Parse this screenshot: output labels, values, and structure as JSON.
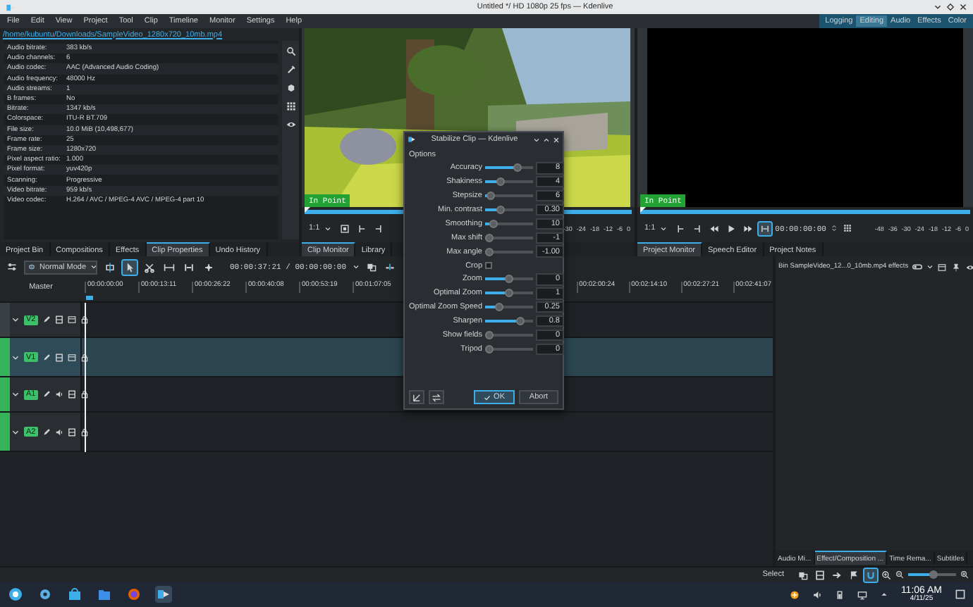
{
  "window": {
    "title": "Untitled */ HD 1080p 25 fps — Kdenlive"
  },
  "menu": [
    "File",
    "Edit",
    "View",
    "Project",
    "Tool",
    "Clip",
    "Timeline",
    "Monitor",
    "Settings",
    "Help"
  ],
  "layouts": [
    {
      "label": "Logging",
      "selected": false
    },
    {
      "label": "Editing",
      "selected": true
    },
    {
      "label": "Audio",
      "selected": false
    },
    {
      "label": "Effects",
      "selected": false
    },
    {
      "label": "Color",
      "selected": false
    }
  ],
  "clip_properties": {
    "path": "/home/kubuntu/Downloads/SampleVideo_1280x720_10mb.mp4",
    "rows": [
      {
        "name": "Audio bitrate:",
        "value": "383 kb/s"
      },
      {
        "name": "Audio channels:",
        "value": "6"
      },
      {
        "name": "Audio codec:",
        "value": "AAC (Advanced Audio Coding)"
      },
      {
        "name": "Audio frequency:",
        "value": "48000 Hz"
      },
      {
        "name": "Audio streams:",
        "value": "1"
      },
      {
        "name": "B frames:",
        "value": "No"
      },
      {
        "name": "Bitrate:",
        "value": "1347 kb/s"
      },
      {
        "name": "Colorspace:",
        "value": "ITU-R BT.709"
      },
      {
        "name": "File size:",
        "value": "10.0 MiB (10,498,677)"
      },
      {
        "name": "Frame rate:",
        "value": "25"
      },
      {
        "name": "Frame size:",
        "value": "1280x720"
      },
      {
        "name": "Pixel aspect ratio:",
        "value": "1.000"
      },
      {
        "name": "Pixel format:",
        "value": "yuv420p"
      },
      {
        "name": "Scanning:",
        "value": "Progressive"
      },
      {
        "name": "Video bitrate:",
        "value": "959 kb/s"
      },
      {
        "name": "Video codec:",
        "value": "H.264 / AVC / MPEG-4 AVC / MPEG-4 part 10"
      }
    ]
  },
  "left_tabs": [
    {
      "label": "Project Bin",
      "selected": false
    },
    {
      "label": "Compositions",
      "selected": false
    },
    {
      "label": "Effects",
      "selected": false
    },
    {
      "label": "Clip Properties",
      "selected": true
    },
    {
      "label": "Undo History",
      "selected": false
    }
  ],
  "clip_monitor": {
    "in_point": "In Point",
    "zoom": "1:1",
    "meter_scale": [
      "-30",
      "-24",
      "-18",
      "-12",
      "-6",
      "0"
    ],
    "tabs": [
      {
        "label": "Clip Monitor",
        "selected": true
      },
      {
        "label": "Library",
        "selected": false
      }
    ]
  },
  "project_monitor": {
    "in_point": "In Point",
    "zoom": "1:1",
    "timecode": "00:00:00:00",
    "meter_scale": [
      "-48",
      "-36",
      "-30",
      "-24",
      "-18",
      "-12",
      "-6",
      "0"
    ],
    "tabs": [
      {
        "label": "Project Monitor",
        "selected": true
      },
      {
        "label": "Speech Editor",
        "selected": false
      },
      {
        "label": "Project Notes",
        "selected": false
      }
    ]
  },
  "timeline": {
    "mode": "Normal Mode",
    "timecode": "00:00:37:21 / 00:00:00:00",
    "tools": [
      {
        "selected": false
      },
      {
        "selected": true
      },
      {
        "selected": false
      },
      {
        "selected": false
      },
      {
        "selected": false
      },
      {
        "selected": false
      }
    ],
    "master": "Master",
    "ruler_left": [
      "00:00:00:00",
      "00:00:13:11",
      "00:00:26:22",
      "00:00:40:08",
      "00:00:53:19",
      "00:01:07:05"
    ],
    "ruler_right": [
      "00:02:00:24",
      "00:02:14:10",
      "00:02:27:21",
      "00:02:41:07"
    ],
    "tracks": [
      {
        "name": "V2",
        "kind": "video",
        "selected": false,
        "target": false
      },
      {
        "name": "V1",
        "kind": "video",
        "selected": true,
        "target": true
      },
      {
        "name": "A1",
        "kind": "audio",
        "selected": false,
        "target": true
      },
      {
        "name": "A2",
        "kind": "audio",
        "selected": false,
        "target": true
      }
    ]
  },
  "effects_panel": {
    "title": "Bin SampleVideo_12...0_10mb.mp4 effects",
    "tabs": [
      {
        "label": "Audio Mi...",
        "selected": false
      },
      {
        "label": "Effect/Composition ...",
        "selected": true
      },
      {
        "label": "Time Rema...",
        "selected": false
      },
      {
        "label": "Subtitles",
        "selected": false
      }
    ]
  },
  "status_bar": {
    "mode": "Select",
    "zoom": {
      "level": 0.55
    }
  },
  "taskbar": {
    "time": "11:06 AM",
    "date": "4/11/25"
  },
  "dialog": {
    "title": "Stabilize Clip — Kdenlive",
    "section": "Options",
    "params": [
      {
        "kind": "slider",
        "label": "Accuracy",
        "value": "8",
        "level": 0.72
      },
      {
        "kind": "slider",
        "label": "Shakiness",
        "value": "4",
        "level": 0.3
      },
      {
        "kind": "slider",
        "label": "Stepsize",
        "value": "6",
        "level": 0.05
      },
      {
        "kind": "slider",
        "label": "Min. contrast",
        "value": "0.30",
        "level": 0.3
      },
      {
        "kind": "slider",
        "label": "Smoothing",
        "value": "10",
        "level": 0.1
      },
      {
        "kind": "slider",
        "label": "Max shift",
        "value": "-1",
        "level": 0
      },
      {
        "kind": "slider",
        "label": "Max angle",
        "value": "-1.00",
        "level": 0
      },
      {
        "kind": "checkbox",
        "label": "Crop",
        "checked": false
      },
      {
        "kind": "slider",
        "label": "Zoom",
        "value": "0",
        "level": 0.5
      },
      {
        "kind": "slider",
        "label": "Optimal Zoom",
        "value": "1",
        "level": 0.5
      },
      {
        "kind": "slider",
        "label": "Optimal Zoom Speed",
        "value": "0.25",
        "level": 0.25
      },
      {
        "kind": "slider",
        "label": "Sharpen",
        "value": "0.8",
        "level": 0.8
      },
      {
        "kind": "slider",
        "label": "Show fields",
        "value": "0",
        "level": 0
      },
      {
        "kind": "slider",
        "label": "Tripod",
        "value": "0",
        "level": 0
      }
    ],
    "buttons": [
      {
        "label": "OK",
        "default": true
      },
      {
        "label": "Abort",
        "default": false
      }
    ]
  }
}
